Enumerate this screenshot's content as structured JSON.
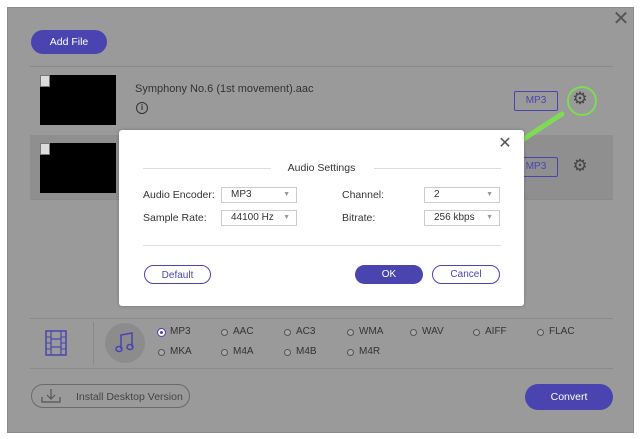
{
  "window": {
    "close_glyph": "✕"
  },
  "toolbar": {
    "add_file_label": "Add File"
  },
  "files": [
    {
      "name": "Symphony No.6 (1st movement).aac",
      "format": "MP3"
    },
    {
      "name": "",
      "format": "MP3"
    }
  ],
  "formats": {
    "selected": "MP3",
    "row1": [
      "MP3",
      "AAC",
      "AC3",
      "WMA",
      "WAV",
      "AIFF",
      "FLAC"
    ],
    "row2": [
      "MKA",
      "M4A",
      "M4B",
      "M4R"
    ]
  },
  "footer": {
    "install_label": "Install Desktop Version",
    "convert_label": "Convert"
  },
  "dialog": {
    "title": "Audio Settings",
    "encoder_label": "Audio Encoder:",
    "encoder_value": "MP3",
    "sample_rate_label": "Sample Rate:",
    "sample_rate_value": "44100 Hz",
    "channel_label": "Channel:",
    "channel_value": "2",
    "bitrate_label": "Bitrate:",
    "bitrate_value": "256 kbps",
    "default_label": "Default",
    "ok_label": "OK",
    "cancel_label": "Cancel"
  },
  "colors": {
    "accent": "#4a44b0",
    "overlay": "#9a9a9a",
    "highlight": "#7ddb54"
  },
  "icons": [
    "close-icon",
    "info-icon",
    "gear-icon",
    "film-icon",
    "music-note-icon",
    "download-icon",
    "caret-down-icon",
    "arrow-annotation"
  ]
}
